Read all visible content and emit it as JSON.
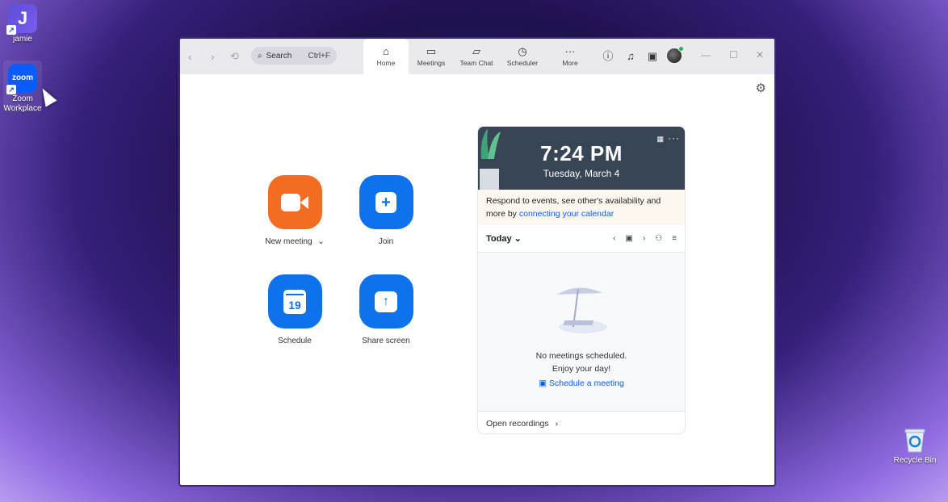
{
  "desktop": {
    "icons": [
      {
        "label": "jamie"
      },
      {
        "label": "Zoom Workplace"
      },
      {
        "label": "Recycle Bin"
      }
    ]
  },
  "titlebar": {
    "search_label": "Search",
    "search_shortcut": "Ctrl+F",
    "tabs": [
      {
        "label": "Home"
      },
      {
        "label": "Meetings"
      },
      {
        "label": "Team Chat"
      },
      {
        "label": "Scheduler"
      },
      {
        "label": "More"
      }
    ]
  },
  "home": {
    "actions": [
      {
        "label": "New meeting",
        "caret": "⌄"
      },
      {
        "label": "Join"
      },
      {
        "label": "Schedule",
        "day": "19"
      },
      {
        "label": "Share screen"
      }
    ]
  },
  "panel": {
    "time": "7:24 PM",
    "date": "Tuesday, March 4",
    "connect_text": "Respond to events, see other's availability and more by ",
    "connect_link": "connecting your calendar",
    "today_label": "Today",
    "empty_line1": "No meetings scheduled.",
    "empty_line2": "Enjoy your day!",
    "schedule_link": "Schedule a meeting",
    "recordings_label": "Open recordings"
  },
  "colors": {
    "accent": "#0e72ed",
    "new_meeting": "#f26d21",
    "clock_bg": "#374554"
  }
}
